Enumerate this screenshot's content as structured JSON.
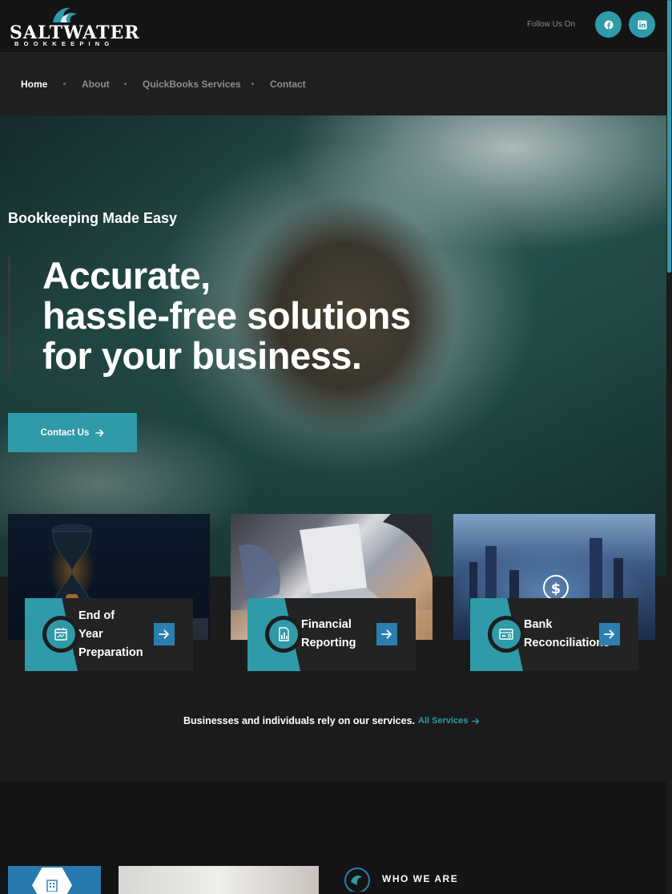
{
  "brand": {
    "name": "SALTWATER",
    "subtitle": "BOOKKEEPING",
    "accent_color": "#2f9aa8"
  },
  "header": {
    "follow_text": "Follow Us On",
    "social": [
      {
        "name": "facebook",
        "icon": "facebook-icon"
      },
      {
        "name": "linkedin",
        "icon": "linkedin-icon"
      }
    ]
  },
  "nav": {
    "items": [
      {
        "label": "Home",
        "active": true
      },
      {
        "label": "About",
        "active": false
      },
      {
        "label": "QuickBooks Services",
        "active": false
      },
      {
        "label": "Contact",
        "active": false
      }
    ]
  },
  "hero": {
    "tagline": "Bookkeeping Made Easy",
    "headline": [
      "Accurate,",
      "hassle-free solutions",
      "for your business."
    ],
    "cta_label": "Contact Us"
  },
  "services": {
    "cards": [
      {
        "title_lines": [
          "End of",
          "Year",
          "Preparation"
        ],
        "icon": "calendar-chart-icon"
      },
      {
        "title_lines": [
          "Financial",
          "Reporting"
        ],
        "icon": "report-chart-icon"
      },
      {
        "title_lines": [
          "Bank",
          "Reconciliations"
        ],
        "icon": "bank-statement-icon"
      }
    ],
    "rely_text": "Businesses and individuals rely on our services.",
    "all_services_label": "All Services"
  },
  "about": {
    "section_label": "WHO WE ARE"
  }
}
